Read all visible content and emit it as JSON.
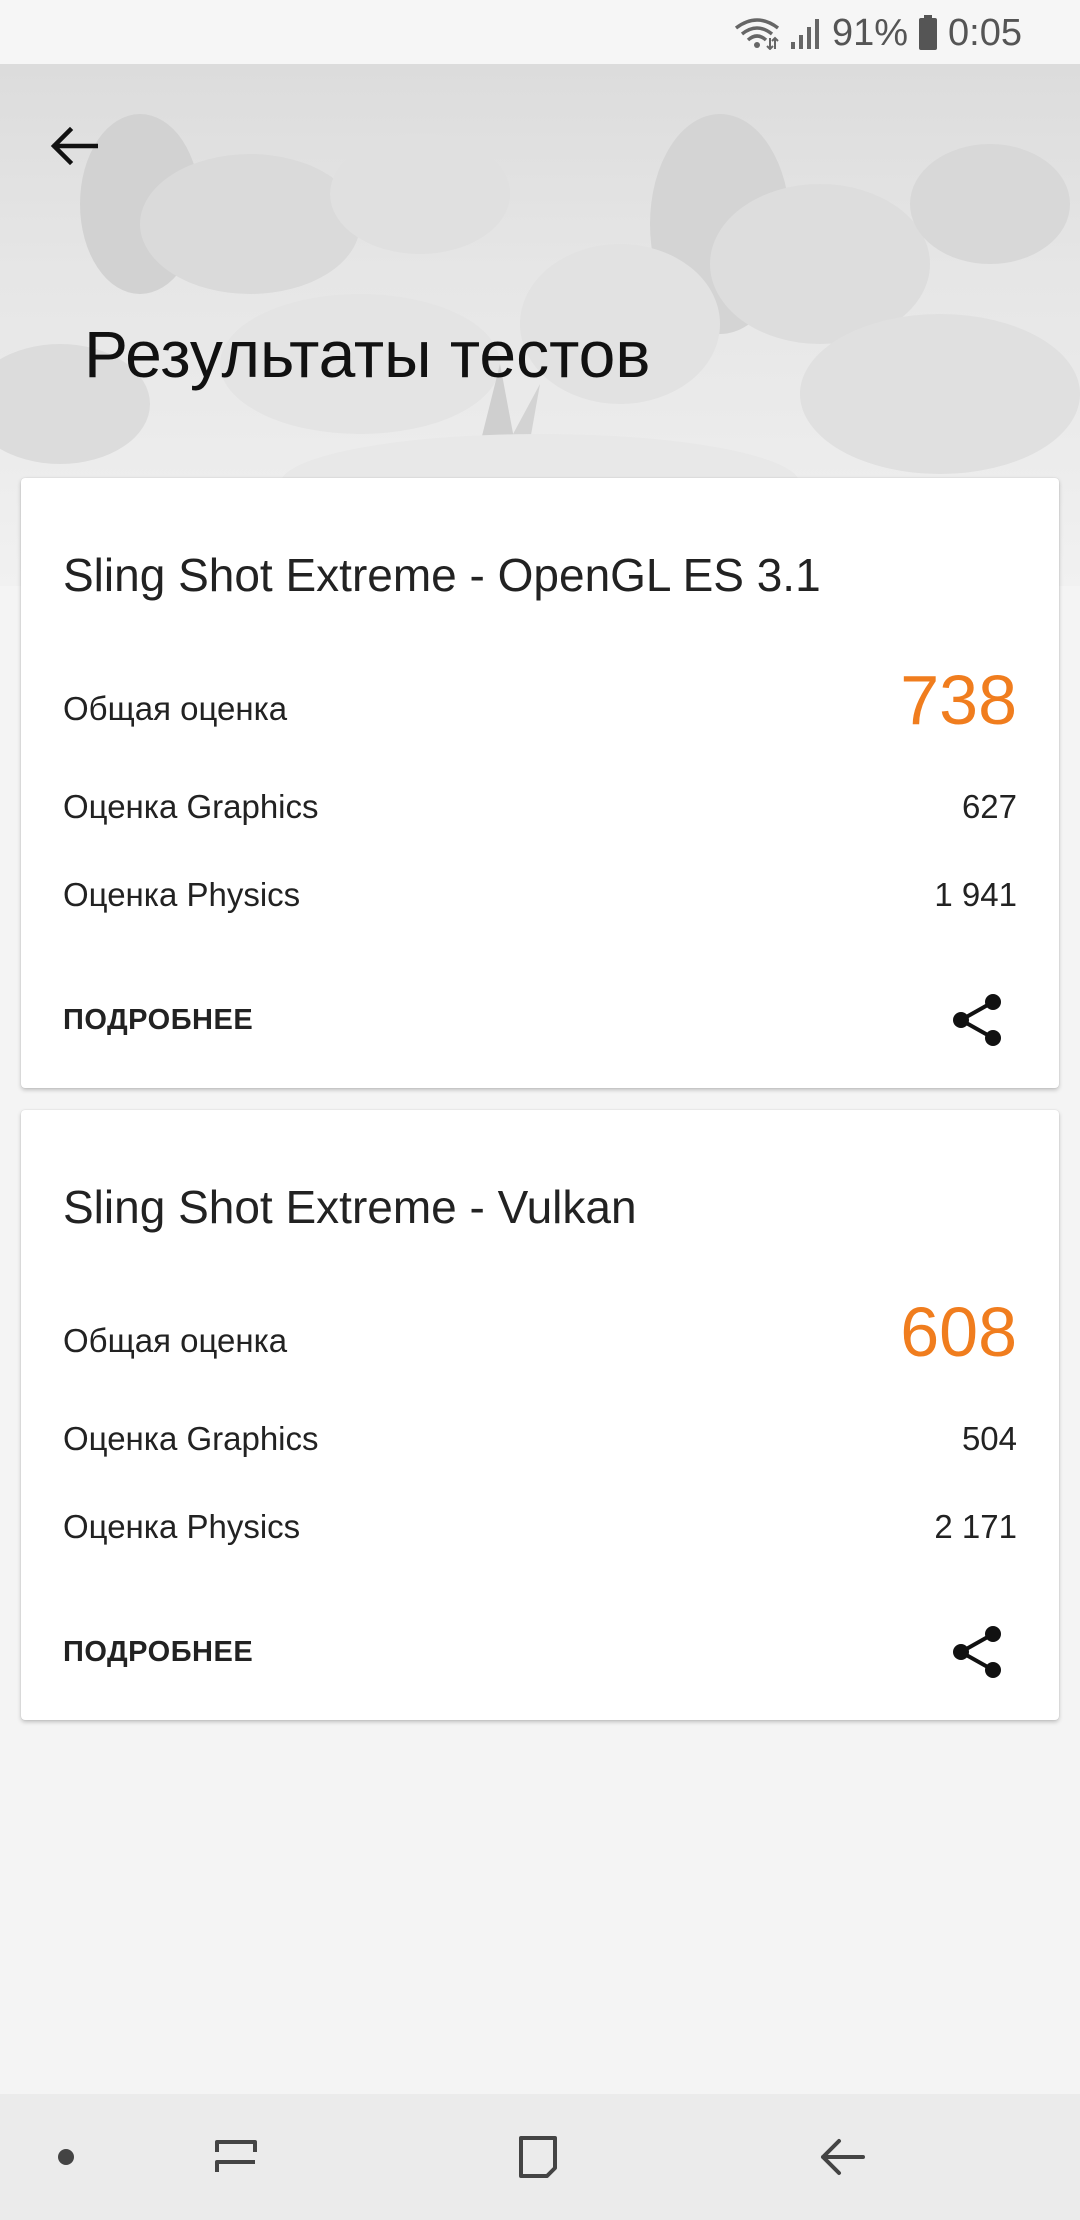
{
  "status_bar": {
    "battery_percent": "91%",
    "time": "0:05",
    "icons": [
      "wifi-icon",
      "signal-icon",
      "battery-icon"
    ]
  },
  "header": {
    "title": "Результаты тестов",
    "back_icon": "arrow-left-icon"
  },
  "accent_color": "#f07d1e",
  "results": [
    {
      "title": "Sling Shot Extreme - OpenGL ES 3.1",
      "overall_label": "Общая оценка",
      "overall_score": "738",
      "graphics_label": "Оценка Graphics",
      "graphics_score": "627",
      "physics_label": "Оценка Physics",
      "physics_score": "1 941",
      "details_label": "ПОДРОБНЕЕ",
      "share_icon": "share-icon"
    },
    {
      "title": "Sling Shot Extreme - Vulkan",
      "overall_label": "Общая оценка",
      "overall_score": "608",
      "graphics_label": "Оценка Graphics",
      "graphics_score": "504",
      "physics_label": "Оценка Physics",
      "physics_score": "2 171",
      "details_label": "ПОДРОБНЕЕ",
      "share_icon": "share-icon"
    }
  ],
  "nav_bar": {
    "icons": [
      "dot-icon",
      "recents-icon",
      "home-icon",
      "back-icon"
    ]
  }
}
